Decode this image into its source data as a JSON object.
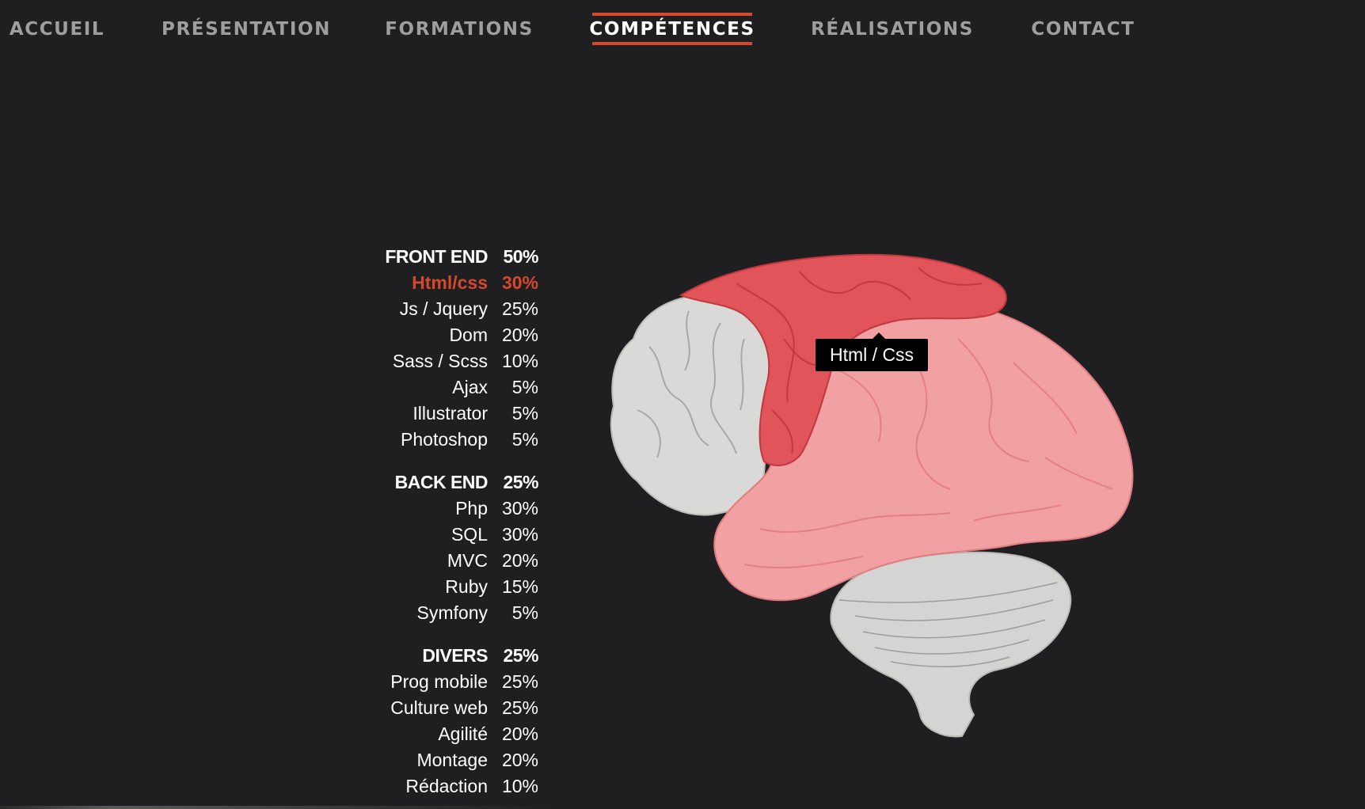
{
  "nav": {
    "items": [
      {
        "label": "ACCUEIL"
      },
      {
        "label": "PRÉSENTATION"
      },
      {
        "label": "FORMATIONS"
      },
      {
        "label": "COMPÉTENCES"
      },
      {
        "label": "RÉALISATIONS"
      },
      {
        "label": "CONTACT"
      }
    ],
    "active_index": 3,
    "accent_color": "#d6472c"
  },
  "skills": {
    "front_end": {
      "name": "FRONT END",
      "percent": "50%",
      "items": [
        {
          "name": "Html/css",
          "percent": "30%"
        },
        {
          "name": "Js / Jquery",
          "percent": "25%"
        },
        {
          "name": "Dom",
          "percent": "20%"
        },
        {
          "name": "Sass / Scss",
          "percent": "10%"
        },
        {
          "name": "Ajax",
          "percent": "5%"
        },
        {
          "name": "Illustrator",
          "percent": "5%"
        },
        {
          "name": "Photoshop",
          "percent": "5%"
        }
      ]
    },
    "back_end": {
      "name": "BACK END",
      "percent": "25%",
      "items": [
        {
          "name": "Php",
          "percent": "30%"
        },
        {
          "name": "SQL",
          "percent": "30%"
        },
        {
          "name": "MVC",
          "percent": "20%"
        },
        {
          "name": "Ruby",
          "percent": "15%"
        },
        {
          "name": "Symfony",
          "percent": "5%"
        }
      ]
    },
    "divers": {
      "name": "DIVERS",
      "percent": "25%",
      "items": [
        {
          "name": "Prog mobile",
          "percent": "25%"
        },
        {
          "name": "Culture web",
          "percent": "25%"
        },
        {
          "name": "Agilité",
          "percent": "20%"
        },
        {
          "name": "Montage",
          "percent": "20%"
        },
        {
          "name": "Rédaction",
          "percent": "10%"
        }
      ]
    }
  },
  "brain": {
    "tooltip": "Html / Css",
    "colors": {
      "gray": "#d4d4d2",
      "red_dark": "#e0545a",
      "red_light": "#f2a1a3"
    }
  }
}
